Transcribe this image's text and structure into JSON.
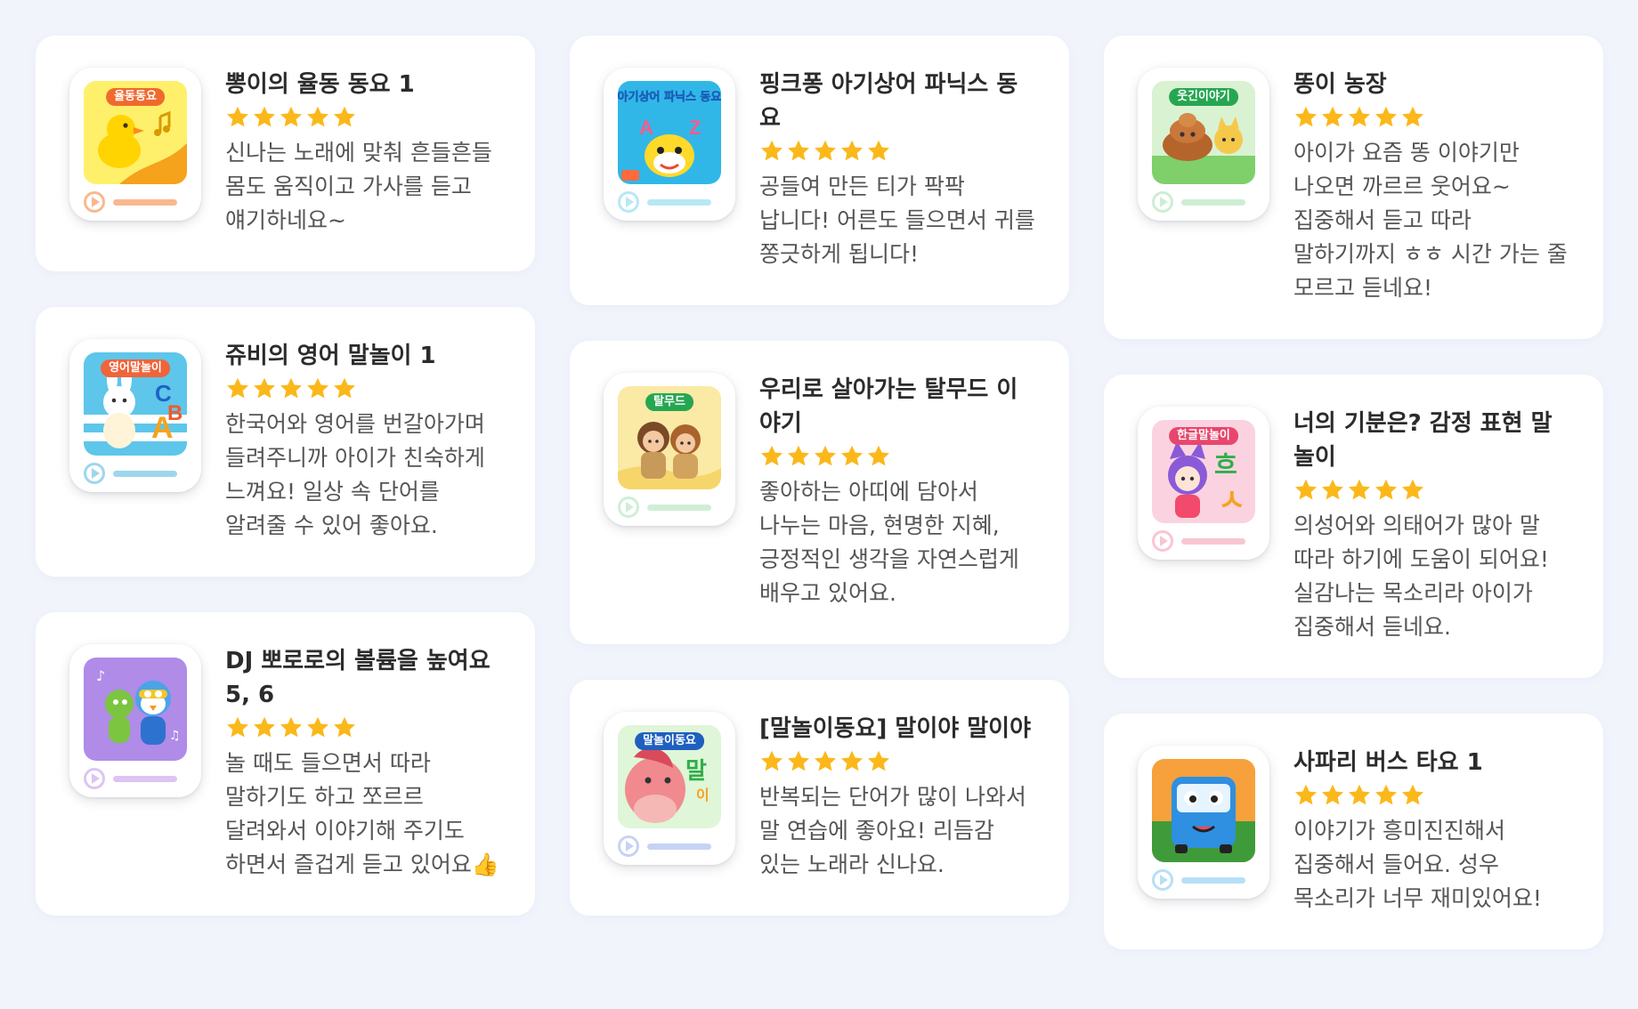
{
  "reviews": [
    {
      "title": "뽕이의 율동 동요 1",
      "rating": 5,
      "tag": "율동동요",
      "tag_color": "#f06a2e",
      "accent": "#f9b88f",
      "art": "duckling-icon",
      "review": "신나는 노래에 맞춰 흔들흔들 몸도 움직이고 가사를 듣고 얘기하네요~"
    },
    {
      "title": "쥬비의 영어 말놀이 1",
      "rating": 5,
      "tag": "영어말놀이",
      "tag_color": "#f0643a",
      "accent": "#9ed6ee",
      "art": "bunny-icon",
      "review": "한국어와 영어를 번갈아가며 들려주니까 아이가 친숙하게 느껴요! 일상 속 단어를 알려줄 수 있어 좋아요."
    },
    {
      "title": "DJ 뽀로로의 볼륨을 높여요 5, 6",
      "rating": 5,
      "tag": "",
      "tag_color": "",
      "accent": "#dcc4f4",
      "art": "pororo-icon",
      "review": "놀 때도 들으면서 따라 말하기도 하고 쪼르르 달려와서 이야기해 주기도 하면서 즐겁게 듣고 있어요👍"
    },
    {
      "title": "핑크퐁 아기상어 파닉스 동요",
      "rating": 5,
      "tag": "아기상어 파닉스 동요",
      "tag_color": "",
      "accent": "#b7e8f6",
      "art": "baby-shark-icon",
      "review": "공들여 만든 티가 팍팍 납니다! 어른도 들으면서 귀를 쫑긋하게 됩니다!"
    },
    {
      "title": "우리로 살아가는 탈무드 이야기",
      "rating": 5,
      "tag": "탈무드",
      "tag_color": "#27a652",
      "accent": "#cfeed5",
      "art": "kids-icon",
      "review": "좋아하는 아띠에 담아서 나누는 마음, 현명한 지혜, 긍정적인 생각을 자연스럽게 배우고 있어요."
    },
    {
      "title": "[말놀이동요] 말이야 말이야",
      "rating": 5,
      "tag": "말놀이동요",
      "tag_color": "#1f5fbf",
      "accent": "#c6d3f6",
      "art": "horse-icon",
      "review": "반복되는 단어가 많이 나와서 말 연습에 좋아요! 리듬감 있는 노래라 신나요."
    },
    {
      "title": "똥이 농장",
      "rating": 5,
      "tag": "웃긴이야기",
      "tag_color": "#27a652",
      "accent": "#cdeed3",
      "art": "poop-icon",
      "review": "아이가 요즘 똥 이야기만 나오면 까르르 웃어요~ 집중해서 듣고 따라 말하기까지 ㅎㅎ 시간 가는 줄 모르고 듣네요!"
    },
    {
      "title": "너의 기분은? 감정 표현 말놀이",
      "rating": 5,
      "tag": "한글말놀이",
      "tag_color": "#e8466d",
      "accent": "#f8c6d3",
      "art": "cat-girl-icon",
      "review": "의성어와 의태어가 많아 말 따라 하기에 도움이 되어요! 실감나는 목소리라 아이가 집중해서 듣네요."
    },
    {
      "title": "사파리 버스 타요 1",
      "rating": 5,
      "tag": "",
      "tag_color": "",
      "accent": "#b7dff6",
      "art": "tayo-bus-icon",
      "review": "이야기가 흥미진진해서 집중해서 들어요. 성우 목소리가 너무 재미있어요!"
    }
  ]
}
